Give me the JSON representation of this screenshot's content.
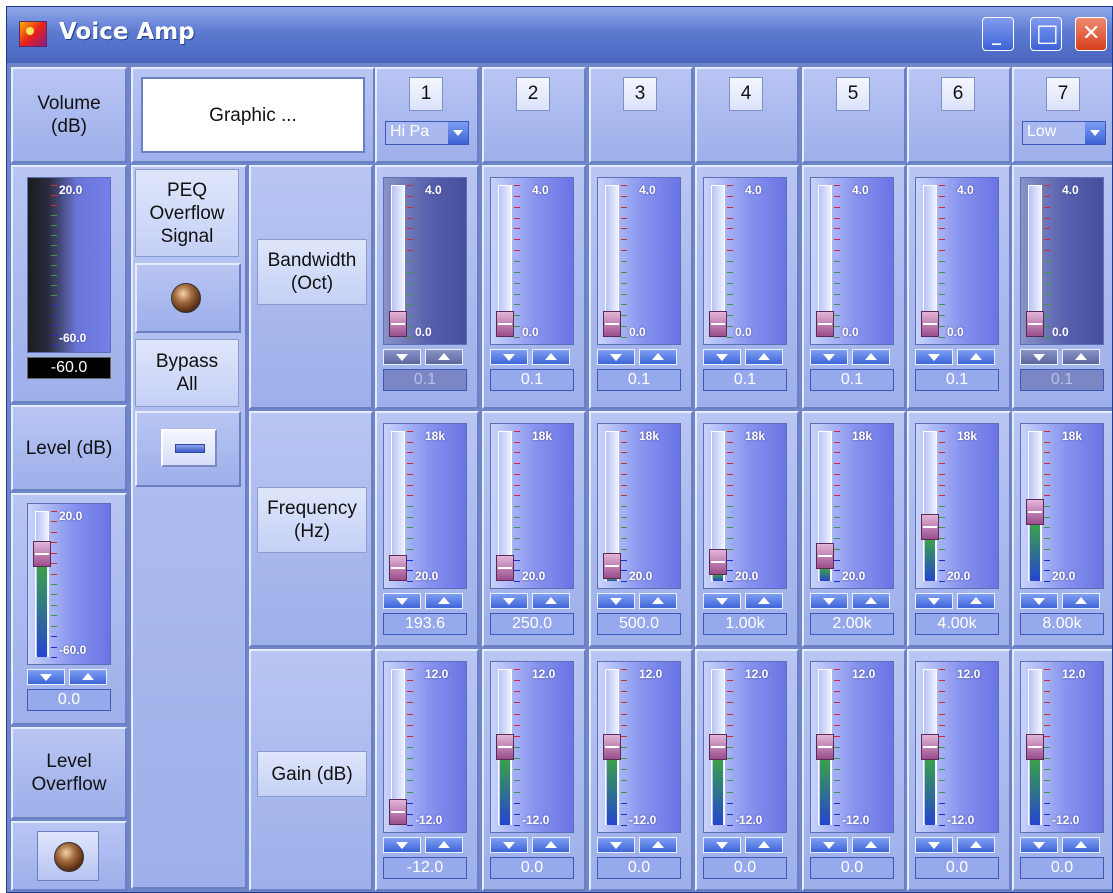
{
  "window": {
    "title": "Voice Amp",
    "buttons": {
      "minimize": "_",
      "maximize": "□",
      "close": "✕"
    }
  },
  "left_panel": {
    "volume_label": "Volume\n(dB)",
    "volume_meter": {
      "max_label": "20.0",
      "min_label": "-60.0",
      "value": "-60.0"
    },
    "level_label": "Level (dB)",
    "level_slider": {
      "max_label": "20.0",
      "min_label": "-60.0",
      "value": "0.0"
    },
    "level_overflow_label": "Level\nOverflow"
  },
  "middle_panel": {
    "preset_name": "Graphic ...",
    "peq_overflow_label": "PEQ\nOverflow\nSignal",
    "bypass_all_label": "Bypass\nAll"
  },
  "row_labels": {
    "bandwidth": "Bandwidth\n(Oct)",
    "frequency": "Frequency\n(Hz)",
    "gain": "Gain (dB)"
  },
  "bands": [
    {
      "number": "1",
      "filter_type": "Hi Pa",
      "bandwidth": "0.1",
      "frequency": "193.6",
      "gain": "-12.0",
      "bandwidth_enabled": false
    },
    {
      "number": "2",
      "filter_type": "",
      "bandwidth": "0.1",
      "frequency": "250.0",
      "gain": "0.0",
      "bandwidth_enabled": true
    },
    {
      "number": "3",
      "filter_type": "",
      "bandwidth": "0.1",
      "frequency": "500.0",
      "gain": "0.0",
      "bandwidth_enabled": true
    },
    {
      "number": "4",
      "filter_type": "",
      "bandwidth": "0.1",
      "frequency": "1.00k",
      "gain": "0.0",
      "bandwidth_enabled": true
    },
    {
      "number": "5",
      "filter_type": "",
      "bandwidth": "0.1",
      "frequency": "2.00k",
      "gain": "0.0",
      "bandwidth_enabled": true
    },
    {
      "number": "6",
      "filter_type": "",
      "bandwidth": "0.1",
      "frequency": "4.00k",
      "gain": "0.0",
      "bandwidth_enabled": true
    },
    {
      "number": "7",
      "filter_type": "Low",
      "bandwidth": "0.1",
      "frequency": "8.00k",
      "gain": "0.0",
      "bandwidth_enabled": false
    }
  ],
  "scales": {
    "bandwidth": {
      "max": "4.0",
      "min": "0.0"
    },
    "frequency": {
      "max": "18k",
      "min": "20.0"
    },
    "gain": {
      "max": "12.0",
      "min": "-12.0"
    }
  },
  "slider_levels": {
    "bandwidth": [
      0.0,
      0.0,
      0.0,
      0.0,
      0.0,
      0.0,
      0.0
    ],
    "frequency": [
      0.0,
      0.0,
      0.02,
      0.05,
      0.1,
      0.33,
      0.45
    ],
    "gain": [
      0.0,
      0.5,
      0.5,
      0.5,
      0.5,
      0.5,
      0.5
    ],
    "level": 0.75,
    "volume": 0.0
  },
  "colors": {
    "window_frame": "#1f3a8a",
    "panel": "#a8b8ee",
    "accent": "#3c63d6"
  }
}
